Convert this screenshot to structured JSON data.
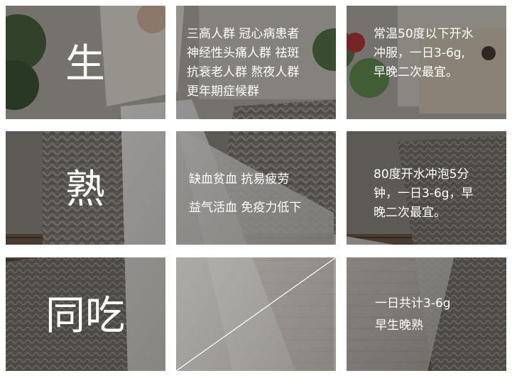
{
  "row1": {
    "heading": "生",
    "audience_lines": [
      "三高人群 冠心病患者",
      "神经性头痛人群 祛斑",
      "抗衰老人群 熬夜人群",
      "更年期症候群"
    ],
    "usage_lines": [
      "常温50度以下开水",
      "冲服，一日3-6g,",
      "早晚二次最宜。"
    ]
  },
  "row2": {
    "heading": "熟",
    "benefit_lines": [
      "缺血贫血  抗易疲劳",
      "益气活血  免疫力低下"
    ],
    "usage_lines": [
      "80度开水冲泡5分",
      "钟，一日3-6g，早",
      "晚二次最宜。"
    ]
  },
  "row3": {
    "heading": "同吃",
    "note_lines": [
      "一日共计3-6g",
      "早生晚熟"
    ]
  },
  "colors": {
    "text": "#ffffff",
    "overlay": "#1e1e1e",
    "gutter": "#ffffff"
  },
  "icons": {
    "tea_box": "packaging-box-icon",
    "chair": "wicker-chair-photo"
  }
}
